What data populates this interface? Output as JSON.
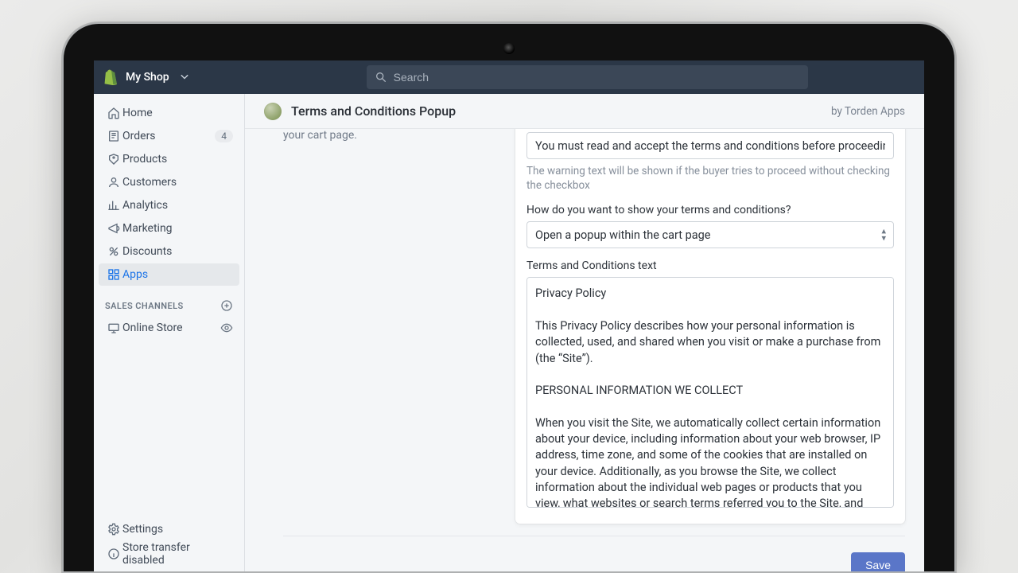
{
  "brand": {
    "shop_name": "My Shop"
  },
  "search": {
    "placeholder": "Search"
  },
  "sidebar": {
    "items": [
      {
        "label": "Home"
      },
      {
        "label": "Orders",
        "badge": "4"
      },
      {
        "label": "Products"
      },
      {
        "label": "Customers"
      },
      {
        "label": "Analytics"
      },
      {
        "label": "Marketing"
      },
      {
        "label": "Discounts"
      },
      {
        "label": "Apps"
      }
    ],
    "sales_channels_title": "SALES CHANNELS",
    "channels": [
      {
        "label": "Online Store"
      }
    ],
    "settings_label": "Settings",
    "transfer_label": "Store transfer disabled"
  },
  "page": {
    "title": "Terms and Conditions Popup",
    "byline": "by Torden Apps",
    "helper_text": "your cart page."
  },
  "form": {
    "warning_value": "You must read and accept the terms and conditions before proceeding to the checkout",
    "warning_hint": "The warning text will be shown if the buyer tries to proceed without checking the checkbox",
    "method_label": "How do you want to show your terms and conditions?",
    "method_value": "Open a popup within the cart page",
    "tc_label": "Terms and Conditions text",
    "tc_value": "Privacy Policy\n\nThis Privacy Policy describes how your personal information is collected, used, and shared when you visit or make a purchase from  (the “Site”).\n\nPERSONAL INFORMATION WE COLLECT\n\nWhen you visit the Site, we automatically collect certain information about your device, including information about your web browser, IP address, time zone, and some of the cookies that are installed on your device. Additionally, as you browse the Site, we collect information about the individual web pages or products that you view, what websites or search terms referred you to the Site, and information about how you interact with the Site. We refer to this automatically-collected information as “Device Information.”",
    "save_label": "Save"
  }
}
